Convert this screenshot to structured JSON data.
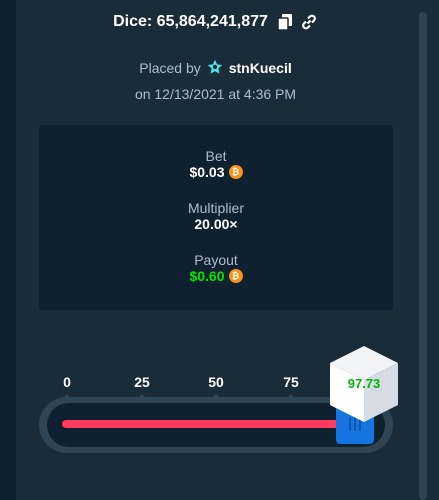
{
  "header": {
    "title": "Dice: 65,864,241,877",
    "copy_icon": "copy-icon",
    "link_icon": "link-icon"
  },
  "placed": {
    "prefix": "Placed by",
    "badge_icon": "star-badge-icon",
    "username": "stnKuecil",
    "date": "on 12/13/2021 at 4:36 PM"
  },
  "stats": {
    "bet_label": "Bet",
    "bet_value": "$0.03",
    "multiplier_label": "Multiplier",
    "multiplier_value": "20.00×",
    "payout_label": "Payout",
    "payout_value": "$0.60",
    "currency_icon": "bitcoin-icon"
  },
  "slider": {
    "ticks": [
      "0",
      "25",
      "50",
      "75"
    ],
    "target": 95,
    "result": "97.73"
  },
  "colors": {
    "background": "#1a2c38",
    "panel": "#0f212e",
    "lose": "#ff3a5c",
    "win": "#00e701",
    "handle": "#1475e1"
  }
}
